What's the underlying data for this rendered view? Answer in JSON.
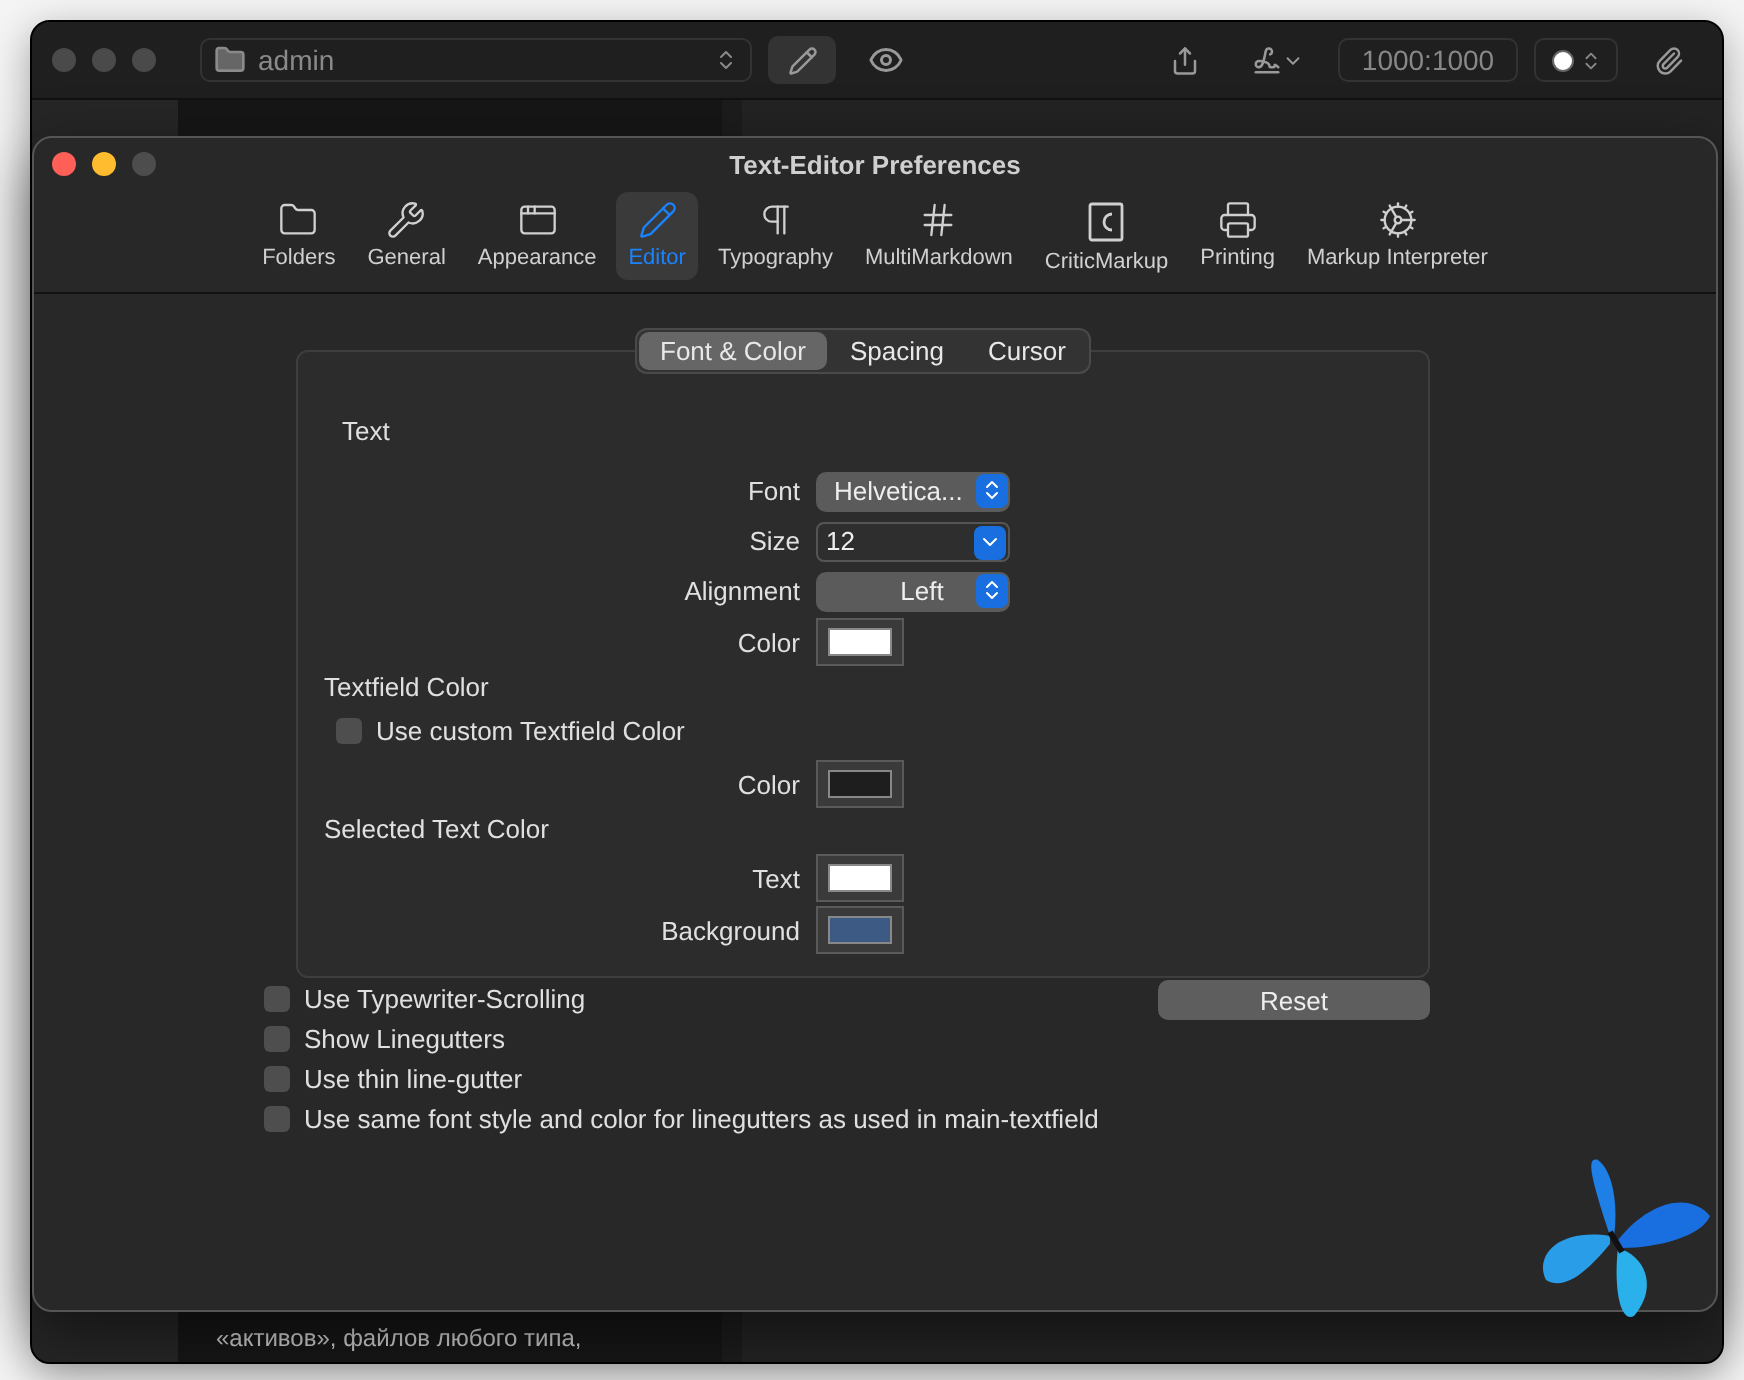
{
  "main_window": {
    "folder": "admin",
    "counter": "1000:1000",
    "note_preview": "«активов», файлов любого типа,"
  },
  "preferences": {
    "title": "Text-Editor Preferences",
    "toolbar": [
      {
        "label": "Folders",
        "selected": false
      },
      {
        "label": "General",
        "selected": false
      },
      {
        "label": "Appearance",
        "selected": false
      },
      {
        "label": "Editor",
        "selected": true
      },
      {
        "label": "Typography",
        "selected": false
      },
      {
        "label": "MultiMarkdown",
        "selected": false
      },
      {
        "label": "CriticMarkup",
        "selected": false
      },
      {
        "label": "Printing",
        "selected": false
      },
      {
        "label": "Markup Interpreter",
        "selected": false
      }
    ],
    "tabs": [
      {
        "label": "Font & Color",
        "selected": true
      },
      {
        "label": "Spacing",
        "selected": false
      },
      {
        "label": "Cursor",
        "selected": false
      }
    ],
    "rows": [
      {
        "kind": "heading",
        "label": "Text"
      },
      {
        "kind": "popup",
        "label": "Font",
        "value": "Helvetica..."
      },
      {
        "kind": "combo",
        "label": "Size",
        "value": "12"
      },
      {
        "kind": "popup",
        "label": "Alignment",
        "value": "Left"
      },
      {
        "kind": "color",
        "label": "Color",
        "color": "#ffffff"
      },
      {
        "kind": "subheading",
        "label": "Textfield Color"
      },
      {
        "kind": "checkbox",
        "label": "Use custom Textfield Color",
        "checked": false
      },
      {
        "kind": "color",
        "label": "Color",
        "color": "#1e1e1e"
      },
      {
        "kind": "subheading",
        "label": "Selected Text Color"
      },
      {
        "kind": "color",
        "label": "Text",
        "color": "#ffffff"
      },
      {
        "kind": "color",
        "label": "Background",
        "color": "#3d5a85"
      }
    ],
    "options": [
      {
        "label": "Use Typewriter-Scrolling",
        "checked": false
      },
      {
        "label": "Show Linegutters",
        "checked": false
      },
      {
        "label": "Use thin line-gutter",
        "checked": false
      },
      {
        "label": "Use same font style and color for linegutters as used in main-textfield",
        "checked": false
      }
    ],
    "reset_button": "Reset"
  }
}
